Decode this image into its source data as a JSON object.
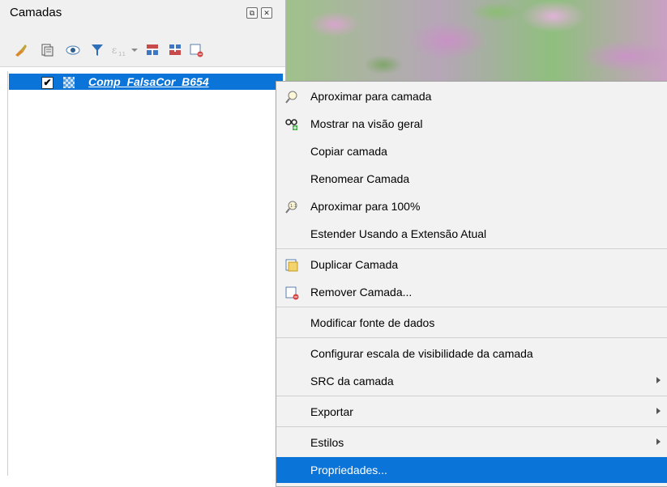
{
  "panel": {
    "title": "Camadas",
    "header_buttons": [
      "⧉",
      "✕"
    ],
    "toolbar_icons": [
      "paint-style-icon",
      "add-group-icon",
      "eye-visibility-icon",
      "filter-icon",
      "filter-expression-icon",
      "dropdown-icon",
      "expand-all-icon",
      "collapse-all-icon",
      "remove-layer-icon"
    ]
  },
  "layer": {
    "checked": "✔",
    "name": "Comp_FalsaCor_B654"
  },
  "menu": {
    "items": [
      {
        "label": "Aproximar para camada",
        "icon": "zoom-icon"
      },
      {
        "label": "Mostrar na visão geral",
        "icon": "overview-icon"
      },
      {
        "label": "Copiar camada",
        "icon": ""
      },
      {
        "label": "Renomear Camada",
        "icon": ""
      },
      {
        "label": "Aproximar para 100%",
        "icon": "zoom-100-icon"
      },
      {
        "label": "Estender Usando a Extensão Atual",
        "icon": ""
      },
      {
        "label": "Duplicar Camada",
        "icon": "duplicate-icon"
      },
      {
        "label": "Remover Camada...",
        "icon": "remove-icon"
      },
      {
        "label": "Modificar fonte de dados",
        "icon": ""
      },
      {
        "label": "Configurar escala de visibilidade da camada",
        "icon": ""
      },
      {
        "label": "SRC da camada",
        "icon": "",
        "submenu": true
      },
      {
        "label": "Exportar",
        "icon": "",
        "submenu": true
      },
      {
        "label": "Estilos",
        "icon": "",
        "submenu": true
      },
      {
        "label": "Propriedades...",
        "icon": "",
        "active": true
      }
    ]
  },
  "colors": {
    "selection": "#0a74d9",
    "menu_bg": "#f2f2f2"
  }
}
